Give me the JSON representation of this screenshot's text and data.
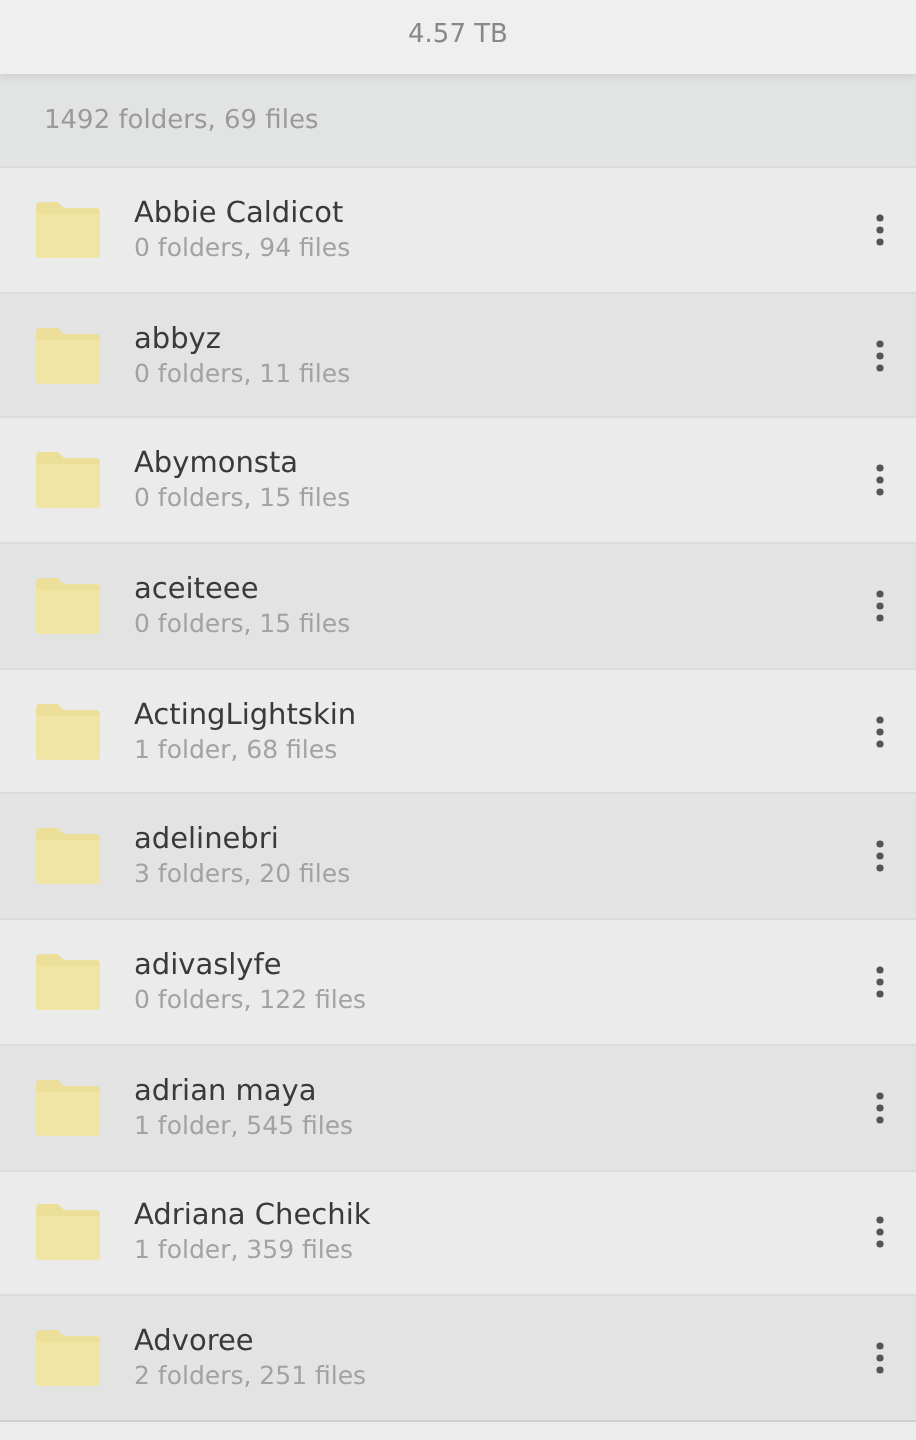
{
  "header": {
    "size": "4.57 TB"
  },
  "summary": "1492 folders, 69 files",
  "folders": [
    {
      "name": "Abbie Caldicot",
      "info": "0 folders, 94 files"
    },
    {
      "name": "abbyz",
      "info": "0 folders, 11 files"
    },
    {
      "name": "Abymonsta",
      "info": "0 folders, 15 files"
    },
    {
      "name": "aceiteee",
      "info": "0 folders, 15 files"
    },
    {
      "name": "ActingLightskin",
      "info": "1 folder, 68 files"
    },
    {
      "name": "adelinebri",
      "info": "3 folders, 20 files"
    },
    {
      "name": "adivaslyfe",
      "info": "0 folders, 122 files"
    },
    {
      "name": "adrian maya",
      "info": "1 folder, 545 files"
    },
    {
      "name": "Adriana Chechik",
      "info": "1 folder, 359 files"
    },
    {
      "name": "Advoree",
      "info": "2 folders, 251 files"
    }
  ]
}
